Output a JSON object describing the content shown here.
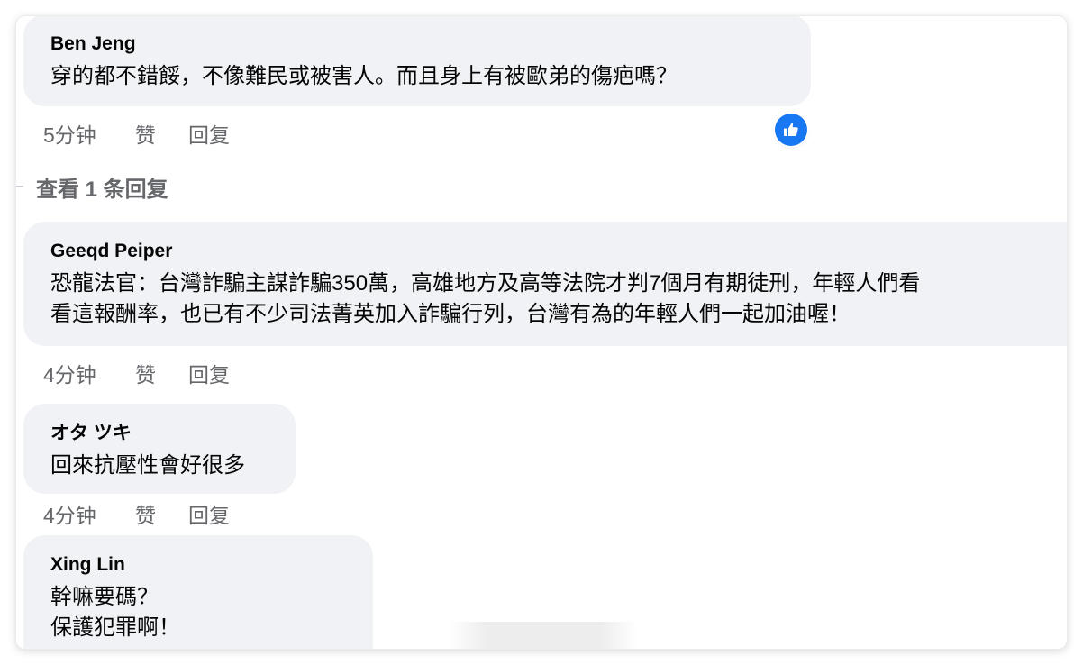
{
  "comments": [
    {
      "author": "Ben Jeng",
      "lines": [
        "穿的都不錯餒，不像難民或被害人。而且身上有被歐弟的傷疤嗎？"
      ],
      "time": "5分钟",
      "like": "赞",
      "reply": "回复",
      "reaction_icon": "thumbs-up-icon",
      "reaction_color": "#1877f2"
    },
    {
      "author": "Geeqd Peiper",
      "lines": [
        "恐龍法官：台灣詐騙主謀詐騙350萬，高雄地方及高等法院才判7個月有期徒刑，年輕人們看",
        "看這報酬率，也已有不少司法菁英加入詐騙行列，台灣有為的年輕人們一起加油喔！"
      ],
      "time": "4分钟",
      "like": "赞",
      "reply": "回复"
    },
    {
      "author": "オタ ツキ",
      "lines": [
        "回來抗壓性會好很多"
      ],
      "time": "4分钟",
      "like": "赞",
      "reply": "回复"
    },
    {
      "author": "Xing Lin",
      "lines": [
        "幹嘛要碼？",
        "保護犯罪啊！"
      ]
    }
  ],
  "view_replies": "查看 1 条回复"
}
